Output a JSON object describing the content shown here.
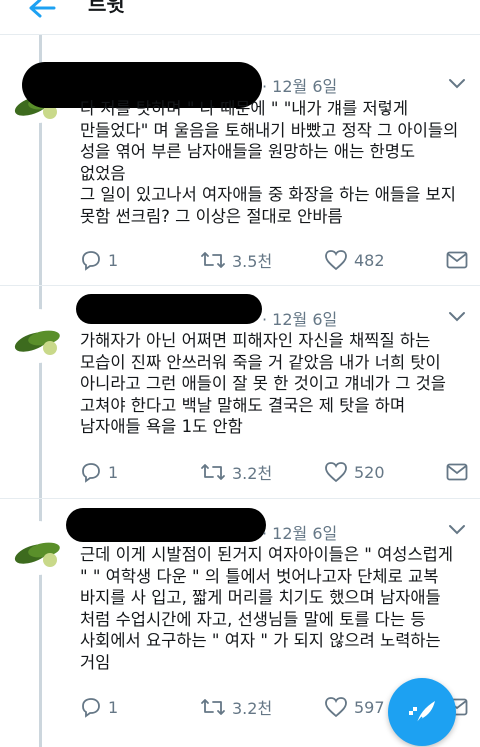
{
  "header": {
    "title": "트윗"
  },
  "tweets": [
    {
      "date": "· 12월 6일",
      "lines": [
        "다 저를 탓하며 \" 나 때문에 \" \"내가 걔를 저렇게",
        "만들었다\" 며 울음을 토해내기 바빴고 정작 그 아이들의",
        "성을 엮어 부른 남자애들을 원망하는 애는 한명도",
        "없었음",
        "그 일이 있고나서 여자애들 중 화장을 하는 애들을 보지",
        "못함 썬크림? 그 이상은 절대로 안바름"
      ],
      "replies": "1",
      "retweets": "3.5천",
      "likes": "482"
    },
    {
      "date": "· 12월 6일",
      "lines": [
        "가해자가 아닌 어쩌면 피해자인 자신을 채찍질 하는",
        "모습이 진짜 안쓰러워 죽을 거 같았음 내가 너희 탓이",
        "아니라고 그런 애들이 잘 못 한 것이고 걔네가 그 것을",
        "고쳐야 한다고 백날 말해도 결국은 제 탓을 하며",
        "남자애들 욕을 1도 안함"
      ],
      "replies": "1",
      "retweets": "3.2천",
      "likes": "520"
    },
    {
      "date": "· 12월 6일",
      "lines": [
        "근데 이게 시발점이 된거지 여자아이들은 \" 여성스럽게",
        "\" \" 여학생 다운 \" 의 틀에서 벗어나고자 단체로 교복",
        "바지를 사 입고, 짧게 머리를 치기도 했으며 남자애들",
        "처럼 수업시간에 자고, 선생님들 말에 토를 다는 등",
        "사회에서 요구하는 \" 여자 \" 가 되지 않으려 노력하는",
        "거임"
      ],
      "replies": "1",
      "retweets": "3.2천",
      "likes": "597"
    }
  ],
  "colors": {
    "accent": "#1da1f2",
    "muted": "#657786",
    "thread_line": "#ccd6dd"
  }
}
